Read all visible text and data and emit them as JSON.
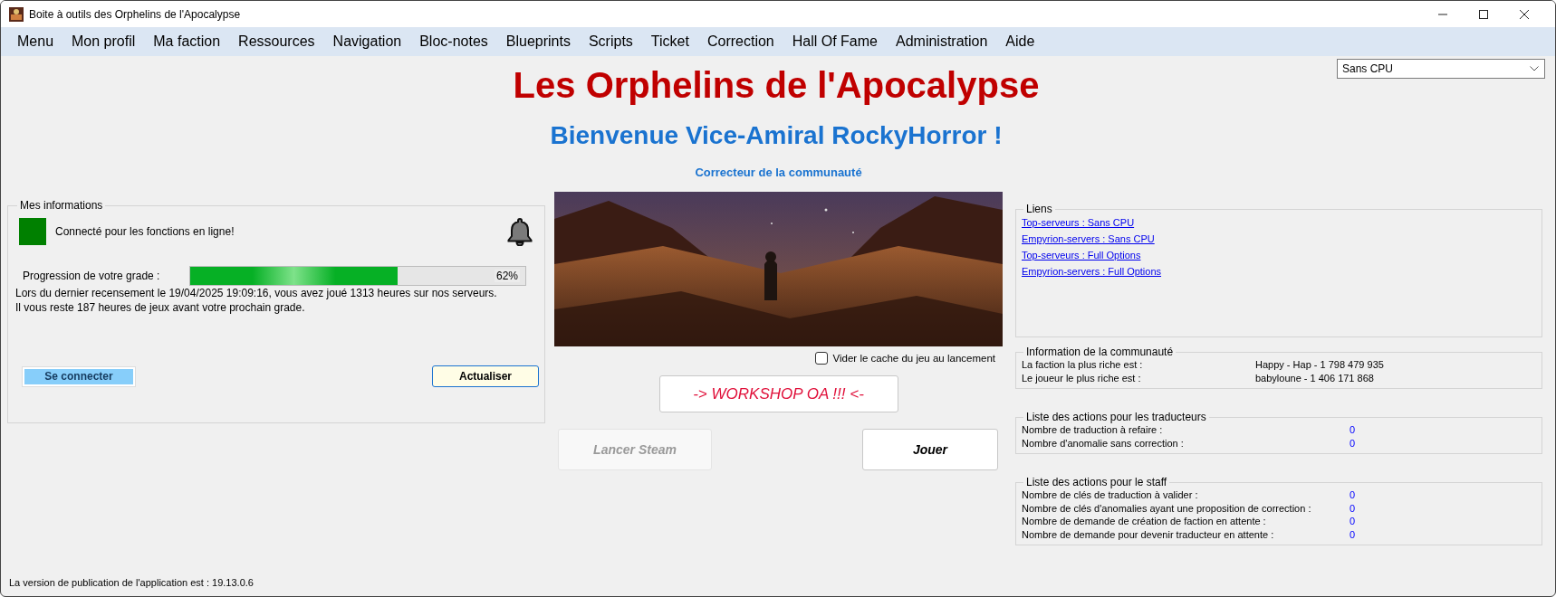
{
  "window": {
    "title": "Boite à outils des Orphelins de l'Apocalypse"
  },
  "menu": [
    "Menu",
    "Mon profil",
    "Ma faction",
    "Ressources",
    "Navigation",
    "Bloc-notes",
    "Blueprints",
    "Scripts",
    "Ticket",
    "Correction",
    "Hall Of Fame",
    "Administration",
    "Aide"
  ],
  "server_select": {
    "value": "Sans CPU"
  },
  "heading": "Les Orphelins de l'Apocalypse",
  "welcome": "Bienvenue Vice-Amiral RockyHorror !",
  "role": "Correcteur de la communauté",
  "my_info": {
    "title": "Mes informations",
    "connected": true,
    "status": "Connecté pour les fonctions en ligne!",
    "progress_label": "Progression de votre grade :",
    "level": 0.62,
    "percent": "62%",
    "census": "Lors du dernier recensement le 19/04/2025 19:09:16, vous avez joué 1313 heures sur nos serveurs.",
    "remaining": "Il vous reste 187 heures de jeux avant votre prochain grade.",
    "login_button": "Se connecter",
    "refresh_button": "Actualiser"
  },
  "clear_cache": {
    "label": "Vider le cache du jeu au lancement",
    "checked": false
  },
  "workshop_button": "-> WORKSHOP OA !!! <-",
  "steam_button": {
    "label": "Lancer Steam",
    "disabled": true
  },
  "play_button": "Jouer",
  "links": {
    "title": "Liens",
    "items": [
      "Top-serveurs : Sans CPU",
      "Empyrion-servers : Sans CPU",
      "Top-serveurs : Full Options",
      "Empyrion-servers : Full Options"
    ]
  },
  "community": {
    "title": "Information de la communauté",
    "rows": [
      {
        "label": "La faction la plus riche est :",
        "value": "Happy - Hap - 1 798 479 935"
      },
      {
        "label": "Le joueur le plus riche est :",
        "value": "babyloune - 1 406 171 868"
      }
    ]
  },
  "translator_actions": {
    "title": "Liste des actions pour les traducteurs",
    "rows": [
      {
        "label": "Nombre de traduction à refaire :",
        "value": "0"
      },
      {
        "label": "Nombre d'anomalie sans correction :",
        "value": "0"
      }
    ]
  },
  "staff_actions": {
    "title": "Liste des actions pour le staff",
    "rows": [
      {
        "label": "Nombre de clés de traduction à valider :",
        "value": "0"
      },
      {
        "label": "Nombre de clés d'anomalies ayant une proposition de correction :",
        "value": "0"
      },
      {
        "label": "Nombre de demande de création de faction en attente :",
        "value": "0"
      },
      {
        "label": "Nombre de demande pour devenir traducteur en attente :",
        "value": "0"
      }
    ]
  },
  "version": "La version de publication de l'application est : 19.13.0.6"
}
